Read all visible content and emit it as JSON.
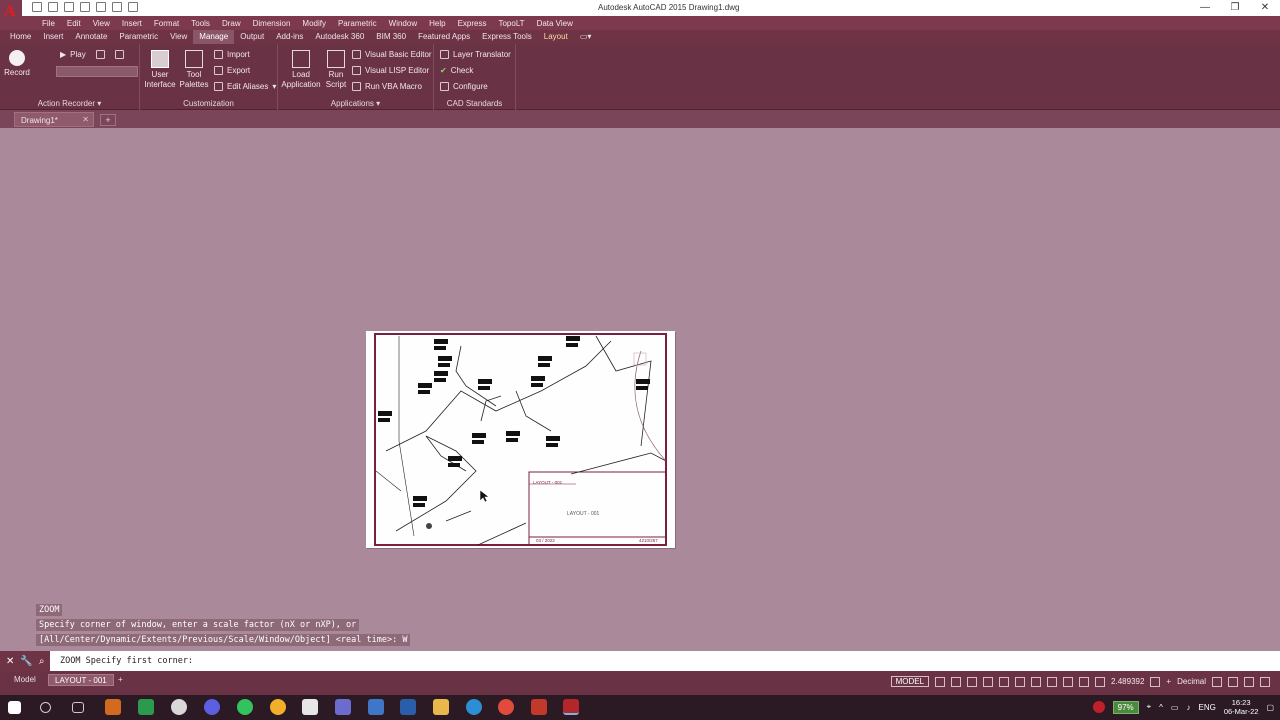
{
  "window": {
    "title": "Autodesk AutoCAD 2015   Drawing1.dwg",
    "logo": "A",
    "controls": [
      "—",
      "❐",
      "✕"
    ]
  },
  "menu": [
    "File",
    "Edit",
    "View",
    "Insert",
    "Format",
    "Tools",
    "Draw",
    "Dimension",
    "Modify",
    "Parametric",
    "Window",
    "Help",
    "Express",
    "TopoLT",
    "Data View"
  ],
  "ribbon_tabs": [
    {
      "label": "Home"
    },
    {
      "label": "Insert"
    },
    {
      "label": "Annotate"
    },
    {
      "label": "Parametric"
    },
    {
      "label": "View"
    },
    {
      "label": "Manage",
      "active": true
    },
    {
      "label": "Output"
    },
    {
      "label": "Add-ins"
    },
    {
      "label": "Autodesk 360"
    },
    {
      "label": "BIM 360"
    },
    {
      "label": "Featured Apps"
    },
    {
      "label": "Express Tools"
    },
    {
      "label": "Layout",
      "contextual": true
    }
  ],
  "ribbon": {
    "action_recorder": {
      "title": "Action Recorder",
      "record": "Record",
      "play": "Play"
    },
    "customization": {
      "title": "Customization",
      "user_interface": "User Interface",
      "tool_palettes": "Tool Palettes",
      "import": "Import",
      "export": "Export",
      "edit_aliases": "Edit Aliases"
    },
    "applications": {
      "title": "Applications",
      "load_application": "Load Application",
      "run_script": "Run Script",
      "vba_editor": "Visual Basic Editor",
      "lisp_editor": "Visual LISP Editor",
      "run_vba": "Run VBA Macro"
    },
    "cad_standards": {
      "title": "CAD Standards",
      "layer_translator": "Layer Translator",
      "check": "Check",
      "configure": "Configure"
    }
  },
  "doc_tab": "Drawing1*",
  "paper": {
    "title_block": "LAYOUT - 001",
    "center_label": "LAYOUT - 001",
    "date": "03 / 2022",
    "code": "4210/257"
  },
  "command": {
    "history": [
      "ZOOM",
      "Specify corner of window, enter a scale factor (nX or nXP), or",
      "[All/Center/Dynamic/Extents/Previous/Scale/Window/Object] <real time>: W"
    ],
    "prompt": "ZOOM Specify first corner:"
  },
  "status": {
    "model_tab": "Model",
    "layout_tab": "LAYOUT - 001",
    "model_button": "MODEL",
    "scale": "2.489392",
    "units": "Decimal"
  },
  "taskbar": {
    "battery": "97%",
    "lang": "ENG",
    "time": "16:23",
    "date": "06-Mar-22"
  },
  "colors": {
    "ribbon": "#6a3345",
    "menubar": "#7d3a4e",
    "canvas": "#a9899a",
    "paper_border": "#7a1f3d",
    "taskbar": "#2b1a23"
  }
}
